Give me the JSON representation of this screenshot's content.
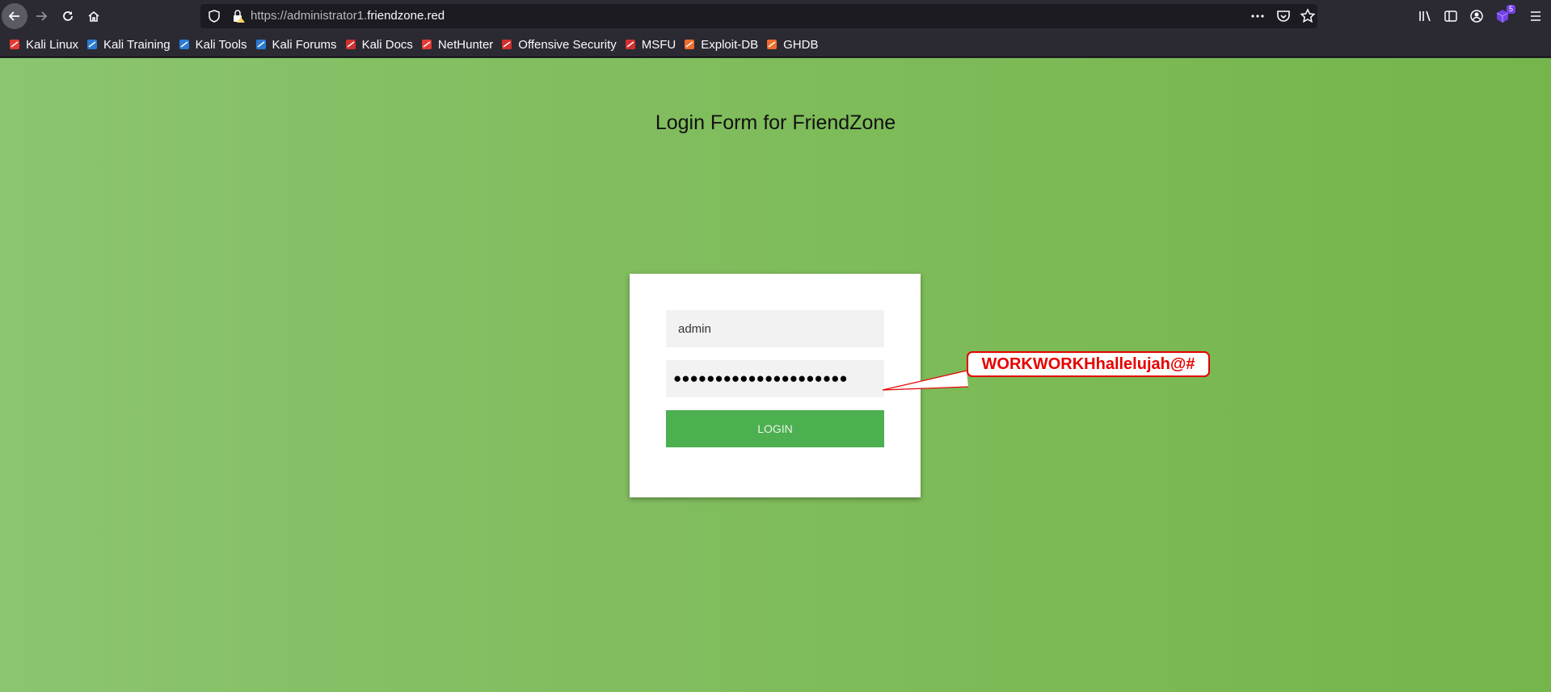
{
  "browser": {
    "url_prefix": "https://administrator1.",
    "url_host": "friendzone.red",
    "extensions_badge": "5",
    "bookmarks": [
      {
        "label": "Kali Linux",
        "icon": "kali-icon"
      },
      {
        "label": "Kali Training",
        "icon": "kali-training-icon"
      },
      {
        "label": "Kali Tools",
        "icon": "kali-tools-icon"
      },
      {
        "label": "Kali Forums",
        "icon": "kali-forums-icon"
      },
      {
        "label": "Kali Docs",
        "icon": "kali-docs-icon"
      },
      {
        "label": "NetHunter",
        "icon": "nethunter-icon"
      },
      {
        "label": "Offensive Security",
        "icon": "offsec-icon"
      },
      {
        "label": "MSFU",
        "icon": "msfu-icon"
      },
      {
        "label": "Exploit-DB",
        "icon": "exploitdb-icon"
      },
      {
        "label": "GHDB",
        "icon": "ghdb-icon"
      }
    ]
  },
  "page": {
    "title": "Login Form for FriendZone",
    "username_value": "admin",
    "password_masked": "●●●●●●●●●●●●●●●●●●●●●",
    "login_label": "LOGIN",
    "annotation": "WORKWORKHhallelujah@#"
  },
  "colors": {
    "accent_button": "#4caf50",
    "annotation_red": "#e60000",
    "page_green": "#7dbb58"
  }
}
